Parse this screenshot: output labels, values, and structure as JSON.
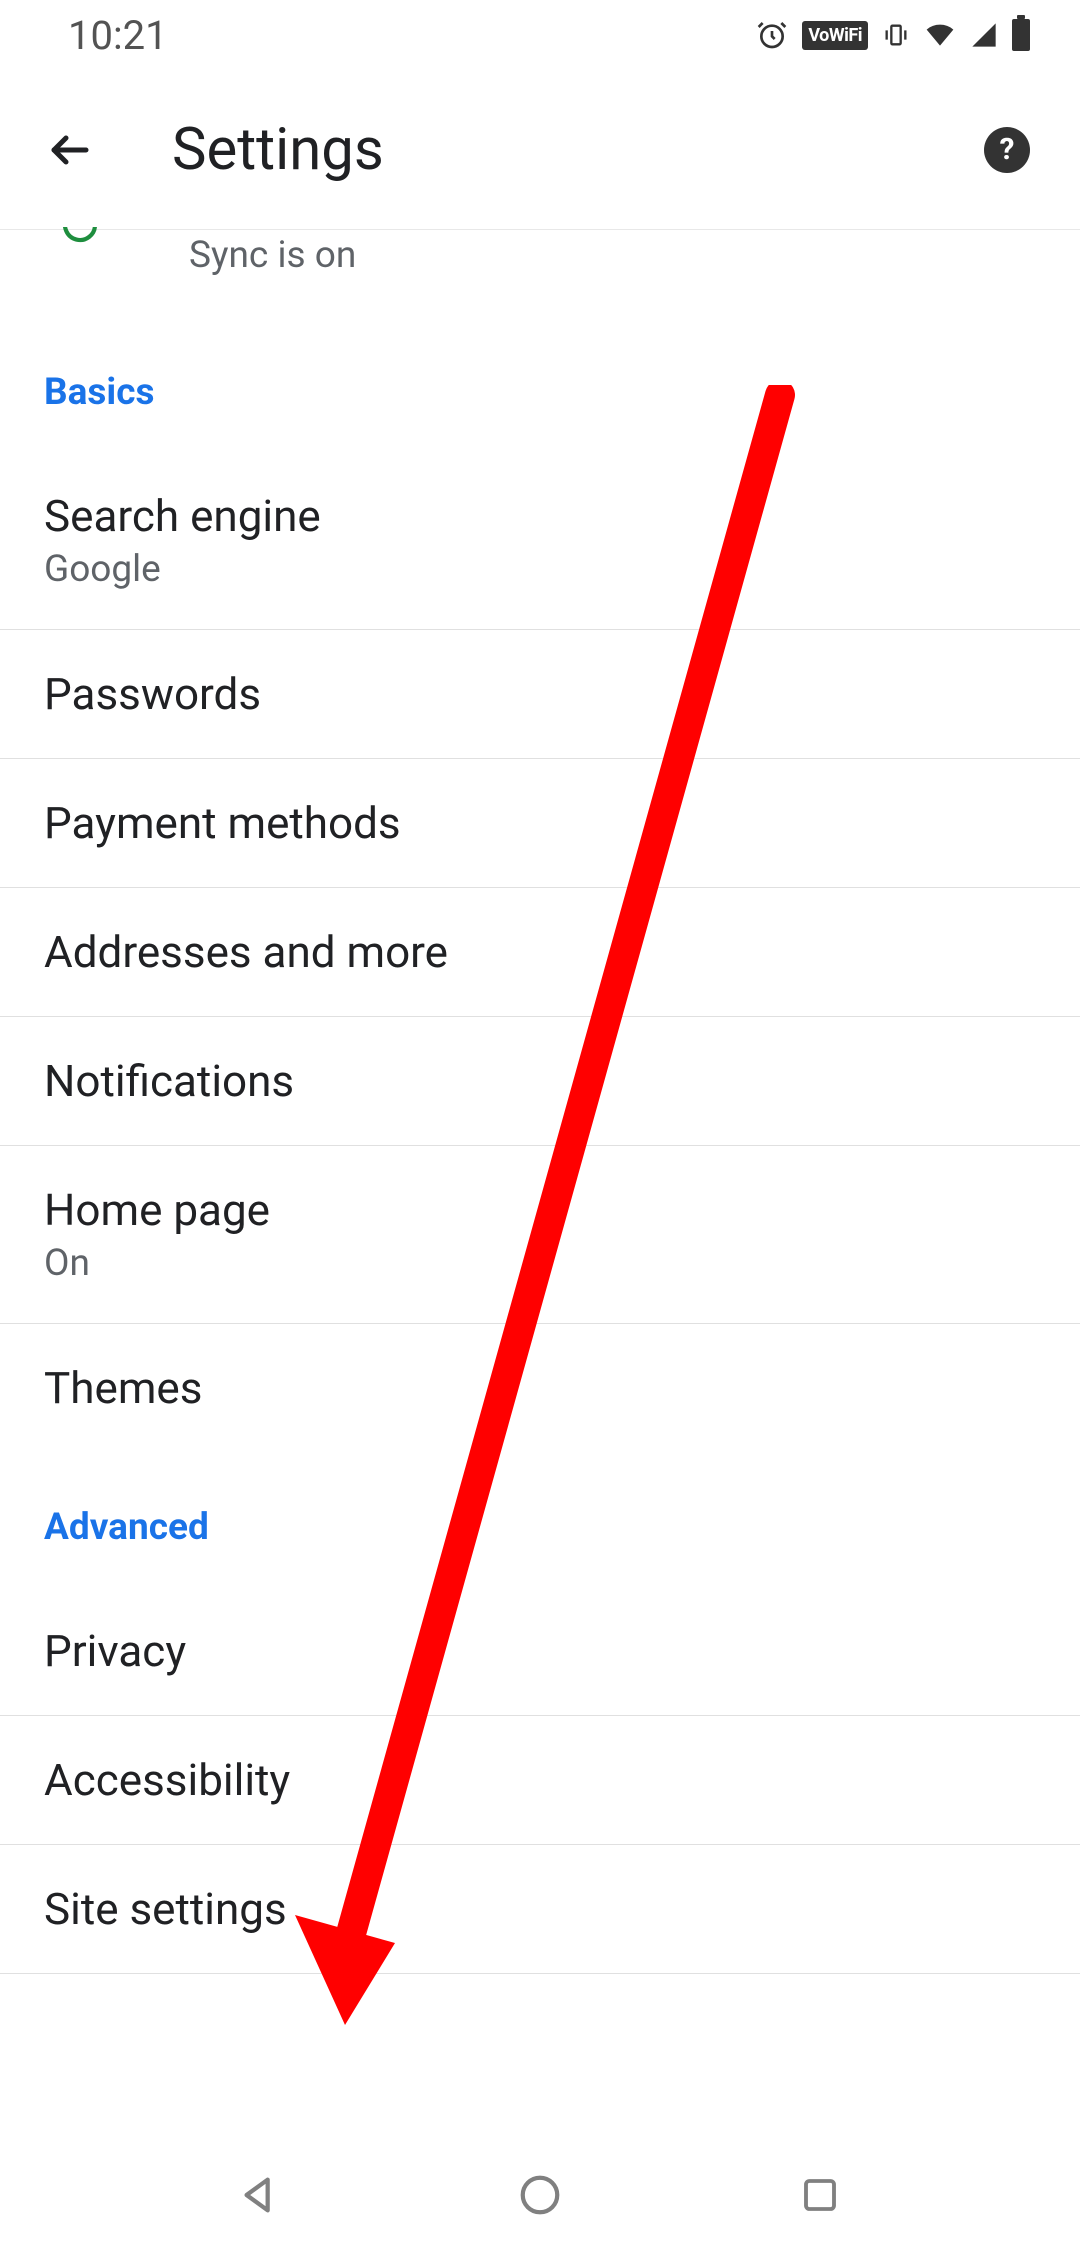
{
  "status_bar": {
    "time": "10:21",
    "vowifi": "VoWiFi"
  },
  "header": {
    "title": "Settings"
  },
  "sync": {
    "subtitle": "Sync is on"
  },
  "sections": {
    "basics": {
      "title": "Basics",
      "items": [
        {
          "title": "Search engine",
          "sub": "Google"
        },
        {
          "title": "Passwords"
        },
        {
          "title": "Payment methods"
        },
        {
          "title": "Addresses and more"
        },
        {
          "title": "Notifications"
        },
        {
          "title": "Home page",
          "sub": "On"
        },
        {
          "title": "Themes"
        }
      ]
    },
    "advanced": {
      "title": "Advanced",
      "items": [
        {
          "title": "Privacy"
        },
        {
          "title": "Accessibility"
        },
        {
          "title": "Site settings"
        }
      ]
    }
  }
}
